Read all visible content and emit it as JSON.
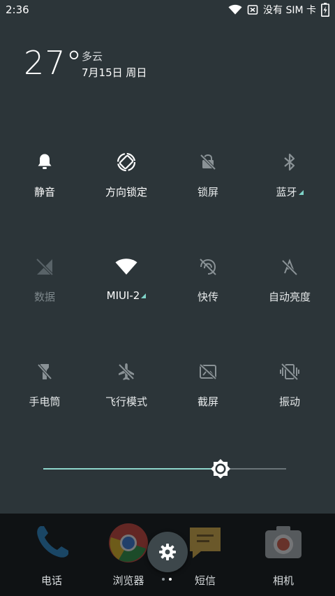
{
  "status_bar": {
    "time": "2:36",
    "sim_text": "没有 SIM 卡"
  },
  "weather": {
    "temperature": "27°",
    "condition": "多云",
    "date": "7月15日 周日"
  },
  "quick_settings": {
    "tiles": [
      {
        "label": "静音",
        "icon": "bell-icon",
        "state": "on"
      },
      {
        "label": "方向锁定",
        "icon": "rotation-lock-icon",
        "state": "on"
      },
      {
        "label": "锁屏",
        "icon": "lock-screen-icon",
        "state": "off"
      },
      {
        "label": "蓝牙",
        "icon": "bluetooth-icon",
        "state": "off",
        "has_menu": true
      },
      {
        "label": "数据",
        "icon": "mobile-data-off-icon",
        "state": "disabled"
      },
      {
        "label": "MIUI-2",
        "icon": "wifi-icon",
        "state": "on",
        "has_menu": true
      },
      {
        "label": "快传",
        "icon": "quick-transfer-icon",
        "state": "off"
      },
      {
        "label": "自动亮度",
        "icon": "auto-brightness-icon",
        "state": "off"
      },
      {
        "label": "手电筒",
        "icon": "flashlight-icon",
        "state": "off"
      },
      {
        "label": "飞行模式",
        "icon": "airplane-icon",
        "state": "off"
      },
      {
        "label": "截屏",
        "icon": "screenshot-icon",
        "state": "off"
      },
      {
        "label": "振动",
        "icon": "vibrate-icon",
        "state": "off"
      }
    ]
  },
  "brightness": {
    "level": 0.73,
    "accent_color": "#8fd6cc"
  },
  "dock": {
    "apps": [
      {
        "label": "电话",
        "icon": "phone-icon"
      },
      {
        "label": "浏览器",
        "icon": "chrome-icon"
      },
      {
        "label": "短信",
        "icon": "messages-icon"
      },
      {
        "label": "相机",
        "icon": "camera-icon"
      }
    ],
    "settings_icon": "gear-icon",
    "page_count": 2,
    "active_page": 2
  }
}
